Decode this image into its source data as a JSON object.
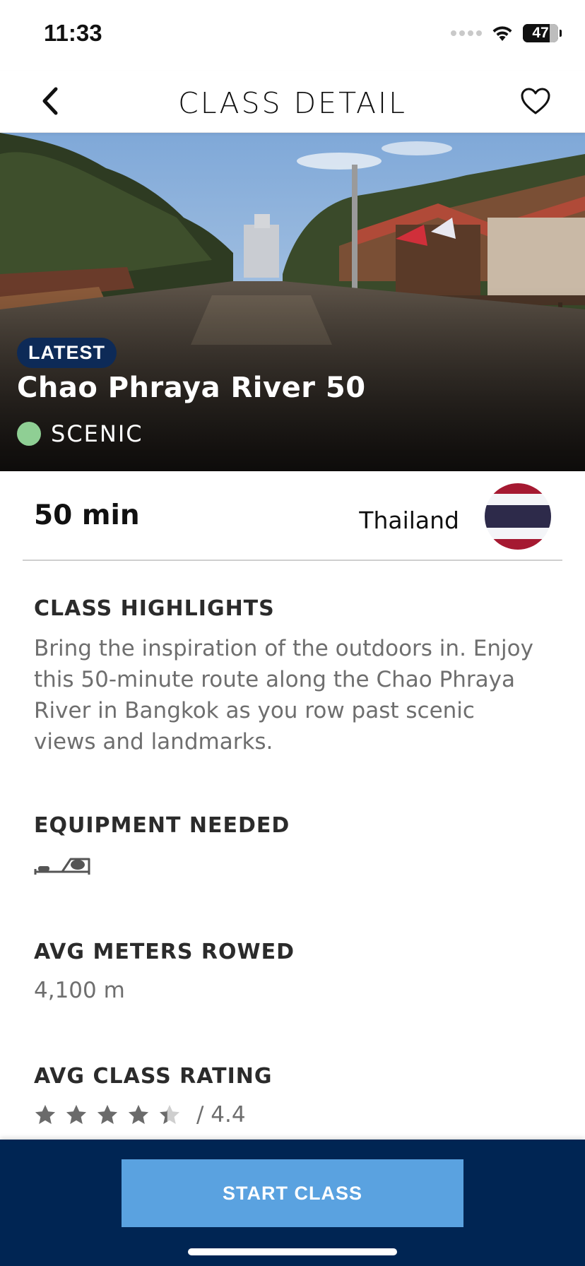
{
  "status_bar": {
    "time": "11:33",
    "battery_level": "47",
    "icons": [
      "signal-icon",
      "wifi-icon",
      "battery-icon"
    ]
  },
  "nav": {
    "title": "CLASS DETAIL",
    "back_icon": "chevron-left-icon",
    "favorite_icon": "heart-outline-icon"
  },
  "hero": {
    "badge": "LATEST",
    "title": "Chao Phraya River 50",
    "category": "SCENIC",
    "category_color": "#8fcf94",
    "image": "river-canal-photo"
  },
  "info": {
    "duration": "50 min",
    "country": "Thailand",
    "flag_icon": "thailand-flag-icon",
    "flag_colors": [
      "#a51931",
      "#f4f5f8",
      "#2d2a4a"
    ]
  },
  "sections": {
    "highlights_heading": "CLASS HIGHLIGHTS",
    "highlights_text": "Bring the inspiration of the outdoors in. Enjoy this 50-minute route along the Chao Phraya River in Bangkok as you row past scenic views and landmarks.",
    "equipment_heading": "EQUIPMENT NEEDED",
    "equipment_icon": "rowing-machine-icon",
    "meters_heading": "AVG METERS ROWED",
    "meters_value": "4,100 m",
    "rating_heading": "AVG CLASS RATING",
    "rating": 4.4,
    "rating_max": 5,
    "rating_label": "/ 4.4"
  },
  "footer": {
    "start_label": "START CLASS",
    "bar_color": "#002553",
    "button_color": "#5aa2e0"
  }
}
